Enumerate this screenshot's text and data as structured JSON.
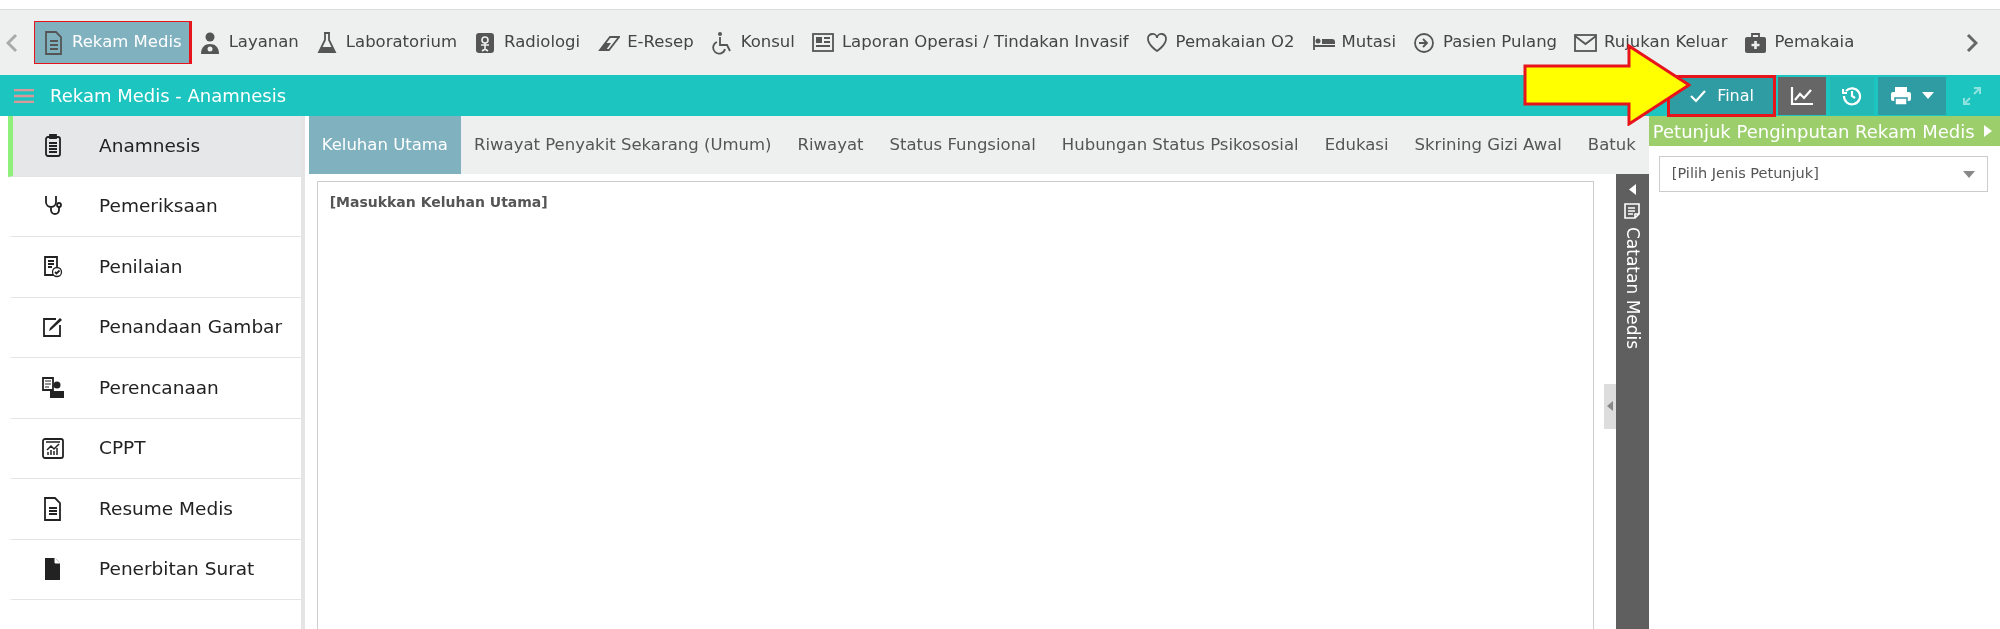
{
  "nav": {
    "items": [
      {
        "label": "Rekam Medis",
        "selected": true,
        "highlighted": true
      },
      {
        "label": "Layanan",
        "selected": false,
        "highlighted": false
      },
      {
        "label": "Laboratorium",
        "selected": false,
        "highlighted": false
      },
      {
        "label": "Radiologi",
        "selected": false,
        "highlighted": false
      },
      {
        "label": "E-Resep",
        "selected": false,
        "highlighted": false
      },
      {
        "label": "Konsul",
        "selected": false,
        "highlighted": false
      },
      {
        "label": "Laporan Operasi / Tindakan Invasif",
        "selected": false,
        "highlighted": false
      },
      {
        "label": "Pemakaian O2",
        "selected": false,
        "highlighted": false
      },
      {
        "label": "Mutasi",
        "selected": false,
        "highlighted": false
      },
      {
        "label": "Pasien Pulang",
        "selected": false,
        "highlighted": false
      },
      {
        "label": "Rujukan Keluar",
        "selected": false,
        "highlighted": false
      },
      {
        "label": "Pemakaia",
        "selected": false,
        "highlighted": false
      }
    ]
  },
  "header": {
    "title": "Rekam Medis - Anamnesis",
    "buttons": [
      {
        "kind": "final",
        "label": "Final",
        "highlighted": true
      },
      {
        "kind": "chart",
        "highlighted": false
      },
      {
        "kind": "history",
        "highlighted": false
      },
      {
        "kind": "print",
        "highlighted": false
      },
      {
        "kind": "expand",
        "highlighted": false
      }
    ]
  },
  "sidebar": {
    "items": [
      {
        "label": "Anamnesis",
        "selected": true
      },
      {
        "label": "Pemeriksaan",
        "selected": false
      },
      {
        "label": "Penilaian",
        "selected": false
      },
      {
        "label": "Penandaan Gambar",
        "selected": false
      },
      {
        "label": "Perencanaan",
        "selected": false
      },
      {
        "label": "CPPT",
        "selected": false
      },
      {
        "label": "Resume Medis",
        "selected": false
      },
      {
        "label": "Penerbitan Surat",
        "selected": false
      }
    ]
  },
  "tabs": [
    {
      "label": "Keluhan Utama",
      "selected": true
    },
    {
      "label": "Riwayat Penyakit Sekarang (Umum)",
      "selected": false
    },
    {
      "label": "Riwayat",
      "selected": false
    },
    {
      "label": "Status Fungsional",
      "selected": false
    },
    {
      "label": "Hubungan Status Psikososial",
      "selected": false
    },
    {
      "label": "Edukasi",
      "selected": false
    },
    {
      "label": "Skrining Gizi Awal",
      "selected": false
    },
    {
      "label": "Batuk",
      "selected": false
    }
  ],
  "editor": {
    "placeholder": "[Masukkan Keluhan Utama]"
  },
  "notes_panel": {
    "title": "Catatan Medis"
  },
  "guide_panel": {
    "title": "Petunjuk Penginputan Rekam Medis",
    "select": {
      "value": "[Pilih Jenis Petunjuk]"
    }
  }
}
